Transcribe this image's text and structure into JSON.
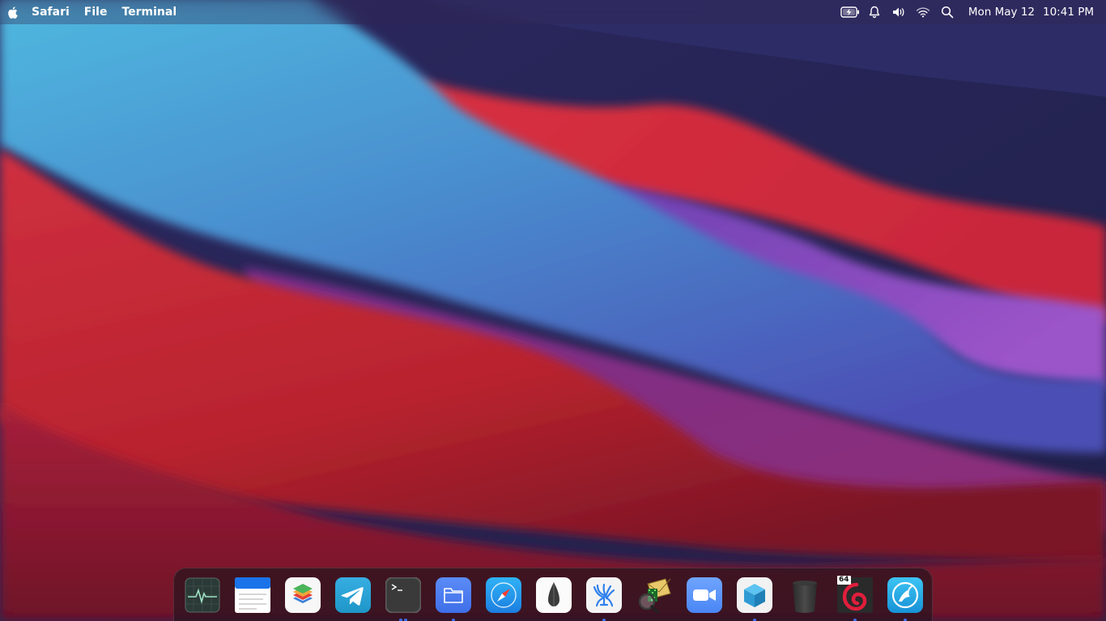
{
  "menubar": {
    "apple_icon": "apple-logo-icon",
    "items": [
      {
        "label": "Safari"
      },
      {
        "label": "File"
      },
      {
        "label": "Terminal"
      }
    ],
    "status": {
      "icons": [
        "battery-charging-icon",
        "notification-bell-icon",
        "volume-icon",
        "wifi-icon",
        "search-icon"
      ],
      "date": "Mon May 12",
      "time": "10:41 PM"
    }
  },
  "dock": {
    "apps": [
      {
        "icon": "activity-monitor-icon",
        "running": false
      },
      {
        "icon": "text-editor-icon",
        "running": false
      },
      {
        "icon": "layers-app-icon",
        "running": false
      },
      {
        "icon": "telegram-icon",
        "running": false
      },
      {
        "icon": "terminal-icon",
        "running": true,
        "dots": 2
      },
      {
        "icon": "files-icon",
        "running": true
      },
      {
        "icon": "safari-icon",
        "running": false
      },
      {
        "icon": "inkscape-pen-icon",
        "running": false
      },
      {
        "icon": "vscodium-icon",
        "running": true
      },
      {
        "icon": "spam-filter-icon",
        "running": false
      },
      {
        "icon": "zoom-icon",
        "running": false
      },
      {
        "icon": "virtualbox-cube-icon",
        "running": true
      },
      {
        "icon": "trash-icon",
        "running": false
      },
      {
        "icon": "debian-64-icon",
        "running": true,
        "badge": "64"
      },
      {
        "icon": "network-app-icon",
        "running": true
      }
    ]
  },
  "colors": {
    "dock_dot": "#3a6df0",
    "wallpaper_blue": "#4aa9d6",
    "wallpaper_red": "#d43036",
    "wallpaper_purple": "#8a4fc4",
    "wallpaper_navy": "#262456"
  }
}
